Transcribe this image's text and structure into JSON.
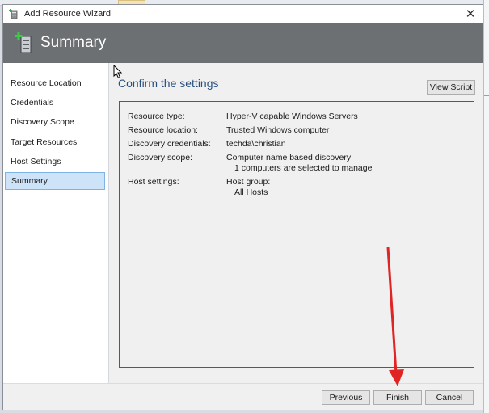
{
  "window": {
    "title": "Add Resource Wizard",
    "close_glyph": "✕"
  },
  "banner": {
    "title": "Summary"
  },
  "nav": {
    "items": [
      {
        "label": "Resource Location"
      },
      {
        "label": "Credentials"
      },
      {
        "label": "Discovery Scope"
      },
      {
        "label": "Target Resources"
      },
      {
        "label": "Host Settings"
      },
      {
        "label": "Summary",
        "selected": true
      }
    ]
  },
  "main": {
    "heading": "Confirm the settings",
    "view_script_label": "View Script",
    "settings": {
      "resource_type": {
        "label": "Resource type:",
        "value": "Hyper-V capable Windows Servers"
      },
      "resource_location": {
        "label": "Resource location:",
        "value": "Trusted Windows computer"
      },
      "discovery_credentials": {
        "label": "Discovery credentials:",
        "value": "techda\\christian"
      },
      "discovery_scope": {
        "label": "Discovery scope:",
        "value": "Computer name based discovery",
        "detail": "1 computers are selected to manage"
      },
      "host_settings": {
        "label": "Host settings:",
        "value": "Host group:",
        "detail": "All Hosts"
      }
    }
  },
  "footer": {
    "previous_label": "Previous",
    "finish_label": "Finish",
    "cancel_label": "Cancel"
  },
  "colors": {
    "banner": "#6d7073",
    "heading": "#2a4f7f",
    "selection": "#cde3f7",
    "annotation_arrow": "#e02424"
  },
  "icons": {
    "app": "server-add-icon",
    "banner": "server-add-icon",
    "close": "close-icon"
  }
}
